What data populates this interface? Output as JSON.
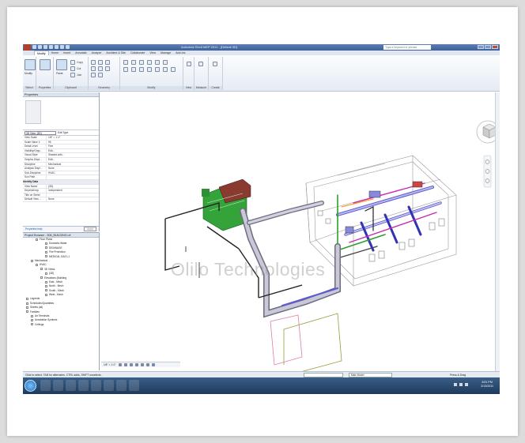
{
  "window": {
    "title": "Autodesk Revit MEP 2011 - [Default 3D]",
    "search_placeholder": "Type a keyword or phrase"
  },
  "tabs": [
    "Modify",
    "Home",
    "Insert",
    "Annotate",
    "Analyze",
    "Architect & Site",
    "Collaborate",
    "View",
    "Manage",
    "Add-Ins"
  ],
  "ribbon": {
    "panels": [
      "Select",
      "Properties",
      "Clipboard",
      "Geometry",
      "Modify",
      "View",
      "Measure",
      "Create"
    ],
    "buttons": {
      "modify": "Modify",
      "paste": "Paste",
      "copy": "Copy",
      "cut": "Cut",
      "join": "Join"
    }
  },
  "properties": {
    "header": "Properties",
    "type_selector": "3D View: {3D}",
    "edit_type": "Edit Type",
    "rows": [
      {
        "k": "View Scale",
        "v": "1/8\" = 1'-0\""
      },
      {
        "k": "Scale Value 1:",
        "v": "96"
      },
      {
        "k": "Detail Level",
        "v": "Fine"
      },
      {
        "k": "Visibility/Grap...",
        "v": "Edit..."
      },
      {
        "k": "Visual Style",
        "v": "Shaded with..."
      },
      {
        "k": "Graphic Displ...",
        "v": "Edit..."
      },
      {
        "k": "Discipline",
        "v": "Mechanical"
      },
      {
        "k": "Analysis Displ...",
        "v": "None"
      },
      {
        "k": "Sub-Discipline",
        "v": "HVAC"
      },
      {
        "k": "Sun Path",
        "v": ""
      }
    ],
    "group": "Identity Data",
    "identity_rows": [
      {
        "k": "View Name",
        "v": "{3D}"
      },
      {
        "k": "Dependency",
        "v": "Independent"
      },
      {
        "k": "Title on Sheet",
        "v": ""
      },
      {
        "k": "Default View ...",
        "v": "None"
      }
    ],
    "help_link": "Properties help",
    "apply": "Apply"
  },
  "browser": {
    "header": "Project Browser - 506_BUILDING.rvt",
    "items": [
      {
        "label": "Floor Plans",
        "indent": 2
      },
      {
        "label": "Domestic Water",
        "indent": 4
      },
      {
        "label": "DRAINAGE",
        "indent": 4
      },
      {
        "label": "Fire Protection",
        "indent": 4
      },
      {
        "label": "MEDICAL GAS L1",
        "indent": 4
      },
      {
        "label": "Mechanical",
        "indent": 1
      },
      {
        "label": "HVAC",
        "indent": 2
      },
      {
        "label": "3D Views",
        "indent": 3
      },
      {
        "label": "{3D}",
        "indent": 4
      },
      {
        "label": "Elevations (Building",
        "indent": 3
      },
      {
        "label": "East - Mech",
        "indent": 4
      },
      {
        "label": "North - Mech",
        "indent": 4
      },
      {
        "label": "South - Mech",
        "indent": 4
      },
      {
        "label": "West - Mech",
        "indent": 4
      },
      {
        "label": "Legends",
        "indent": 0
      },
      {
        "label": "Schedules/Quantities",
        "indent": 0
      },
      {
        "label": "Sheets (all)",
        "indent": 0
      },
      {
        "label": "Families",
        "indent": 0
      },
      {
        "label": "Air Terminals",
        "indent": 1
      },
      {
        "label": "Annotation Symbols",
        "indent": 1
      },
      {
        "label": "Ceilings",
        "indent": 1
      }
    ]
  },
  "view_control": {
    "scale": "1/8\" = 1'-0\""
  },
  "status": {
    "hint": "Click to select, TAB for alternates, CTRL adds, SHIFT unselects.",
    "model": "Main Model",
    "press_drag": "Press & Drag"
  },
  "taskbar": {
    "time": "8:51 PM",
    "date": "2/13/2011"
  },
  "watermark": "Olilo Technologies",
  "colors": {
    "titlebar": "#3e6196",
    "duct": "#a6a6c8",
    "pipe_green": "#2aa02a",
    "pipe_blue": "#2a2ac8",
    "pipe_magenta": "#c82ab4",
    "accent_red": "#b03030"
  }
}
